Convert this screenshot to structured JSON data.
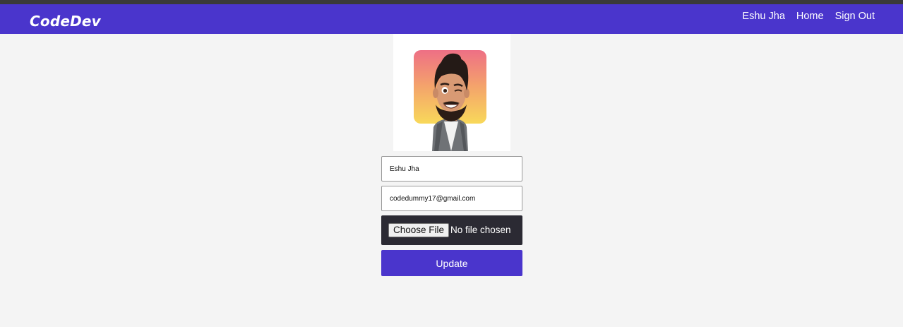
{
  "navbar": {
    "brand": "CodeDev",
    "links": {
      "user": "Eshu Jha",
      "home": "Home",
      "signout": "Sign Out"
    }
  },
  "profile": {
    "avatar_icon": "memoji-avatar",
    "name_value": "Eshu Jha",
    "email_value": "codedummy17@gmail.com",
    "file_button": "Choose File",
    "file_status": "No file chosen",
    "update_label": "Update"
  },
  "colors": {
    "accent": "#4a35cc",
    "background": "#f4f4f4",
    "file_box": "#2b2a33"
  }
}
